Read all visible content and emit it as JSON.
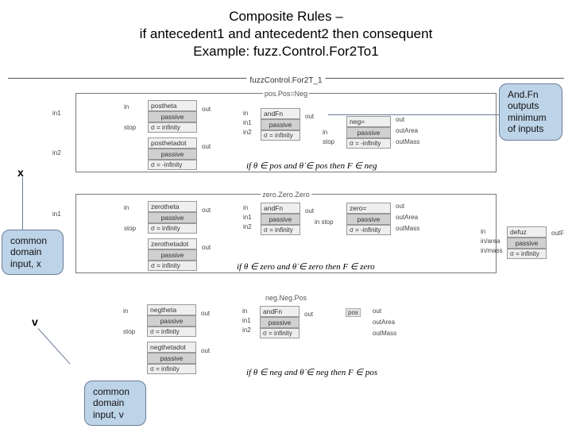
{
  "title": {
    "line1": "Composite Rules –",
    "line2": "if antecedent1 and antecedent2 then consequent",
    "line3": "Example: fuzz.Control.For2To1"
  },
  "diagram": {
    "header": "fuzzControl.For2T_1",
    "frame_titles": {
      "top": "pos.Pos=Neg",
      "middle": "zero.Zero.Zero",
      "bottom": "neg.Neg.Pos"
    }
  },
  "callouts": {
    "andfn": "And.Fn outputs minimum of inputs",
    "common_x": "common domain input, x",
    "common_v": "common domain input, v"
  },
  "markers": {
    "x": "x",
    "v": "v"
  },
  "nodes": {
    "postheta": "postheta",
    "posthetadot": "posthetadot",
    "zerotheta": "zerotheta",
    "zerothetadot": "zerothetadot",
    "negtheta": "negtheta",
    "negthetadot": "negthetadot",
    "passive": "passive",
    "sigma_inf": "σ = infinity",
    "sigma_ninf": "σ = -infinity",
    "andfn": "andFn",
    "neg": "neg=",
    "zero": "zero=",
    "pos": "pos",
    "defuz": "defuz",
    "stop": "stop",
    "in": "in",
    "in1": "in1",
    "in2": "in2",
    "out": "out",
    "outArea": "outArea",
    "outMass": "outMass",
    "outF": "outF",
    "inArea": "in/area",
    "inMass": "in/mass"
  },
  "formulas": {
    "top": "if θ ∈ pos and θ̇ ∈ pos then F ∈ neg",
    "mid": "if θ ∈ zero and θ̇ ∈ zero then F ∈ zero",
    "bot": "if θ ∈ neg and θ̇ ∈ neg then F ∈ pos"
  }
}
